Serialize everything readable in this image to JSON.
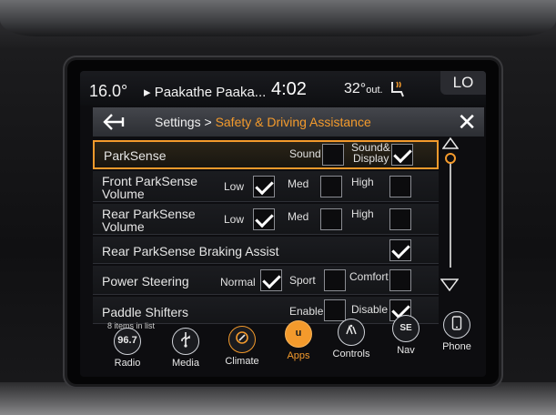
{
  "status": {
    "temperature": "16.0°",
    "location": "Paakathe Paaka...",
    "time": "4:02",
    "outside_temp": "32°",
    "outside_suffix": "out.",
    "lo_label": "LO"
  },
  "titlebar": {
    "root": "Settings",
    "separator": " > ",
    "leaf": "Safety & Driving Assistance"
  },
  "rows": {
    "parksense": {
      "label": "ParkSense",
      "opt_sound": "Sound",
      "opt_sound_display_1": "Sound&",
      "opt_sound_display_2": "Display",
      "sound_checked": false,
      "sound_display_checked": true
    },
    "front_volume": {
      "label_1": "Front ParkSense",
      "label_2": "Volume",
      "opt_low": "Low",
      "opt_med": "Med",
      "opt_high": "High",
      "selected": "Low"
    },
    "rear_volume": {
      "label_1": "Rear ParkSense",
      "label_2": "Volume",
      "opt_low": "Low",
      "opt_med": "Med",
      "opt_high": "High",
      "selected": "Low"
    },
    "braking_assist": {
      "label": "Rear ParkSense Braking Assist",
      "checked": true
    },
    "power_steering": {
      "label": "Power Steering",
      "opt_normal": "Normal",
      "opt_sport": "Sport",
      "opt_comfort": "Comfort",
      "selected": "Normal"
    },
    "paddle_shifters": {
      "label": "Paddle Shifters",
      "opt_enable": "Enable",
      "opt_disable": "Disable",
      "selected": "Disable"
    }
  },
  "list_info": "8 items in list",
  "dock": [
    {
      "label": "Radio",
      "glyph": "96.7",
      "icon": "radio-icon"
    },
    {
      "label": "Media",
      "glyph": "",
      "icon": "usb-icon"
    },
    {
      "label": "Climate",
      "glyph": "",
      "icon": "climate-icon"
    },
    {
      "label": "Apps",
      "glyph": "u",
      "icon": "apps-icon",
      "active": true
    },
    {
      "label": "Controls",
      "glyph": "",
      "icon": "controls-icon"
    },
    {
      "label": "Nav",
      "glyph": "SE",
      "icon": "compass-icon"
    },
    {
      "label": "Phone",
      "glyph": "",
      "icon": "phone-icon"
    }
  ],
  "colors": {
    "accent": "#f39a2c",
    "screen_bg": "#0d0d10",
    "text": "#e8e8e8"
  }
}
